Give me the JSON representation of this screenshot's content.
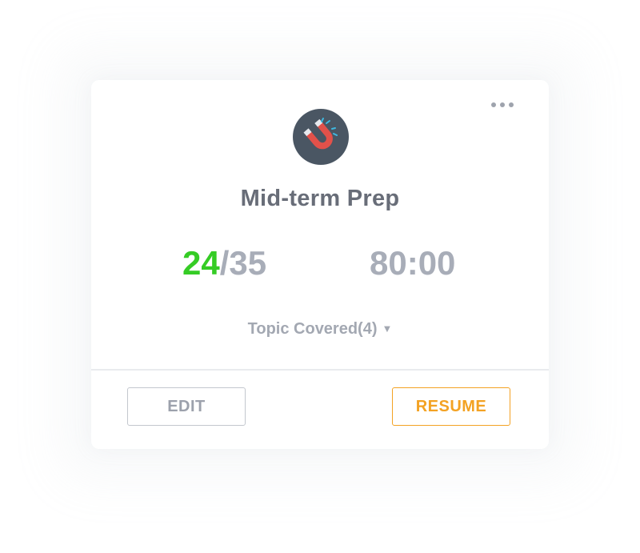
{
  "card": {
    "title": "Mid-term Prep",
    "icon": "magnet-icon",
    "score": {
      "correct": "24",
      "separator": "/",
      "total": "35"
    },
    "timer": "80:00",
    "topics_label": "Topic Covered(4)",
    "topics_caret": "▼",
    "menu_icon": "more-horizontal-icon"
  },
  "actions": {
    "edit_label": "EDIT",
    "resume_label": "RESUME"
  },
  "colors": {
    "correct": "#35cc25",
    "accent": "#f3a223",
    "icon_bg": "#4a5663",
    "magnet_red": "#e2514a",
    "spark": "#3fb8e0"
  }
}
